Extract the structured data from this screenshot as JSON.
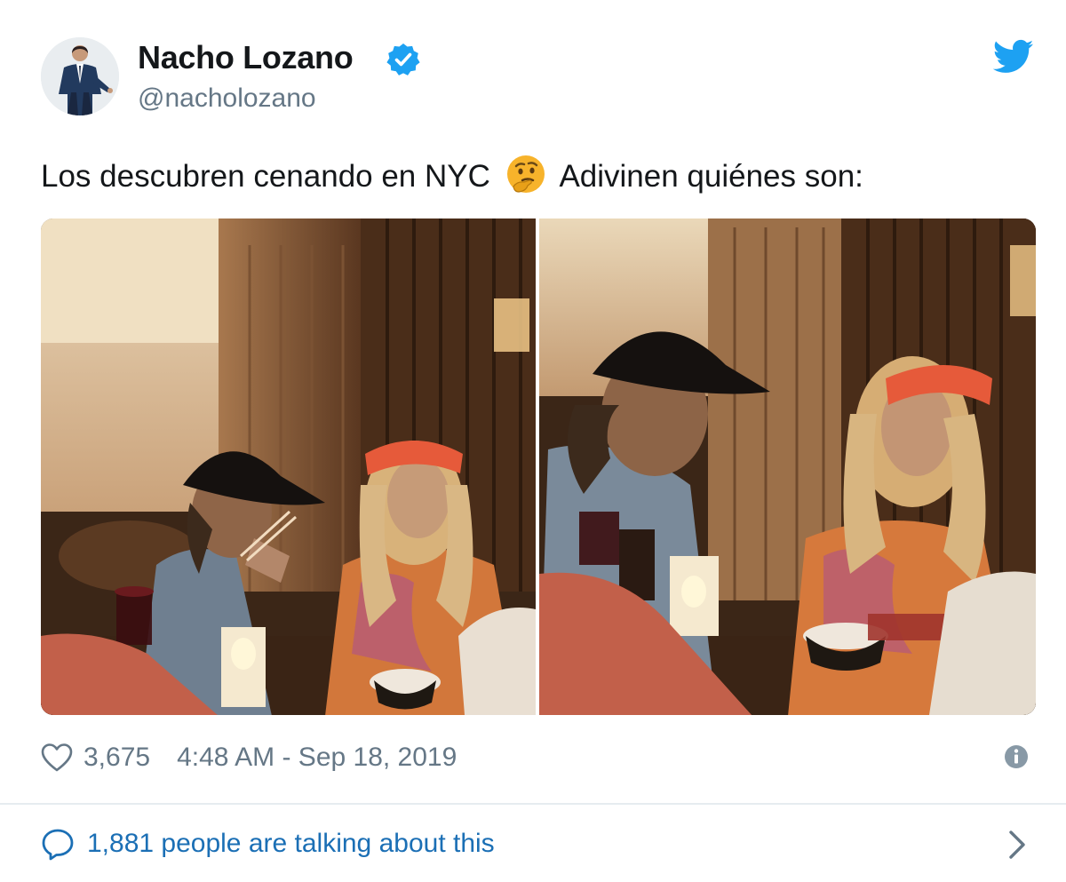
{
  "tweet": {
    "display_name": "Nacho Lozano",
    "handle": "@nacholozano",
    "text_before_emoji": "Los descubren cenando en NYC",
    "emoji": "thinking-face-emoji",
    "text_after_emoji": "Adivinen quiénes son:",
    "like_count": "3,675",
    "timestamp": "4:48 AM - Sep 18, 2019",
    "talking_text": "1,881 people are talking about this"
  },
  "colors": {
    "twitter_blue": "#1da1f2",
    "link_blue": "#1b6fb5",
    "secondary_gray": "#657786",
    "verified_blue": "#1da1f2"
  },
  "icons": [
    "verified-badge-icon",
    "twitter-bird-icon",
    "heart-icon",
    "info-icon",
    "speech-bubble-icon",
    "chevron-right-icon"
  ]
}
